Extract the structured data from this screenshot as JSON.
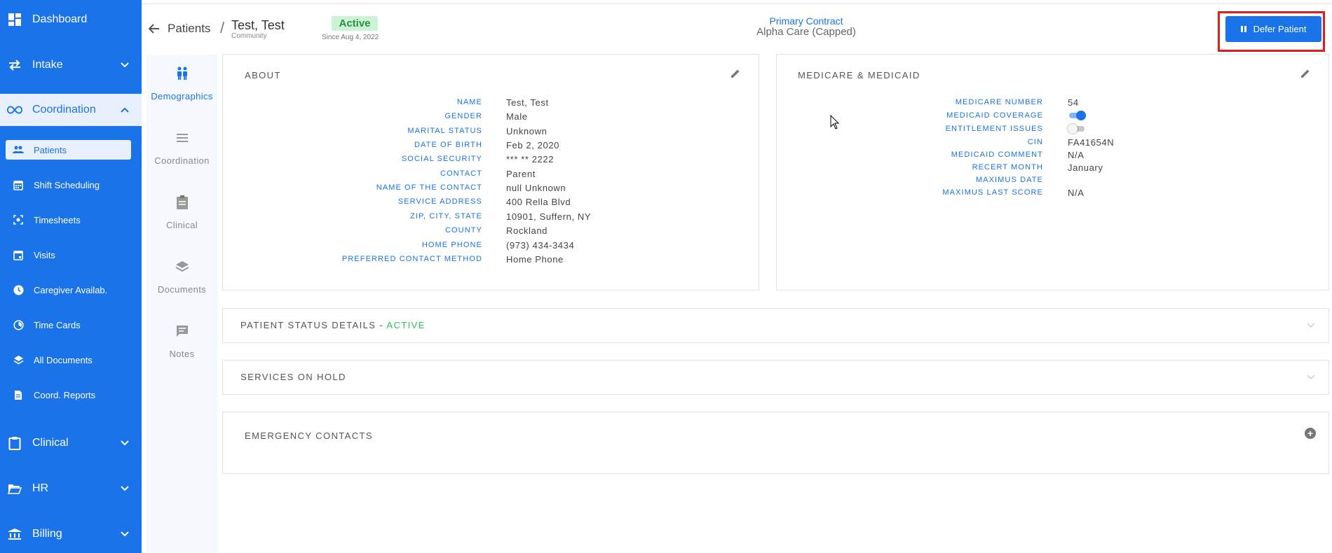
{
  "colors": {
    "primary": "#1a73e8",
    "active_green": "#2cbf5c",
    "badge_bg": "#ccf3d6",
    "highlight_red": "#e41b1b"
  },
  "sidebar": {
    "groups": [
      {
        "label": "Dashboard",
        "icon": "dashboard-icon"
      },
      {
        "label": "Intake",
        "icon": "swap-arrows-icon"
      },
      {
        "label": "Coordination",
        "icon": "infinity-icon"
      },
      {
        "label": "Clinical",
        "icon": "clipboard-icon"
      },
      {
        "label": "HR",
        "icon": "folder-open-icon"
      },
      {
        "label": "Billing",
        "icon": "bank-icon"
      }
    ],
    "coordination_items": [
      {
        "label": "Patients",
        "icon": "people-icon",
        "active": true
      },
      {
        "label": "Shift Scheduling",
        "icon": "calendar-icon"
      },
      {
        "label": "Timesheets",
        "icon": "scan-icon"
      },
      {
        "label": "Visits",
        "icon": "calendar-event-icon"
      },
      {
        "label": "Caregiver Availab.",
        "icon": "clock-icon"
      },
      {
        "label": "Time Cards",
        "icon": "timelapse-icon"
      },
      {
        "label": "All Documents",
        "icon": "layers-icon"
      },
      {
        "label": "Coord. Reports",
        "icon": "document-icon"
      }
    ]
  },
  "header": {
    "breadcrumb": "Patients",
    "patient_name": "Test, Test",
    "patient_type": "Community",
    "status": "Active",
    "since": "Since Aug 4, 2022",
    "contract_label": "Primary Contract",
    "contract_value": "Alpha Care (Capped)",
    "defer_label": "Defer Patient"
  },
  "tabs": [
    {
      "label": "Demographics",
      "icon": "people-icon",
      "active": true
    },
    {
      "label": "Coordination",
      "icon": "list-icon"
    },
    {
      "label": "Clinical",
      "icon": "clipboard-icon"
    },
    {
      "label": "Documents",
      "icon": "layers-icon"
    },
    {
      "label": "Notes",
      "icon": "chat-icon"
    }
  ],
  "about": {
    "title": "ABOUT",
    "fields": [
      {
        "label": "NAME",
        "value": "Test, Test"
      },
      {
        "label": "GENDER",
        "value": "Male"
      },
      {
        "label": "MARITAL STATUS",
        "value": "Unknown"
      },
      {
        "label": "DATE OF BIRTH",
        "value": "Feb 2, 2020"
      },
      {
        "label": "SOCIAL SECURITY",
        "value": "*** ** 2222"
      },
      {
        "label": "CONTACT",
        "value": "Parent"
      },
      {
        "label": "NAME OF THE CONTACT",
        "value": "null Unknown"
      },
      {
        "label": "SERVICE ADDRESS",
        "value": "400 Rella Blvd"
      },
      {
        "label": "ZIP, CITY, STATE",
        "value": "10901, Suffern, NY"
      },
      {
        "label": "COUNTY",
        "value": "Rockland"
      },
      {
        "label": "HOME PHONE",
        "value": "(973) 434-3434"
      },
      {
        "label": "PREFERRED CONTACT METHOD",
        "value": "Home Phone"
      }
    ]
  },
  "medicare": {
    "title": "MEDICARE & MEDICAID",
    "fields": [
      {
        "label": "MEDICARE NUMBER",
        "value": "54"
      },
      {
        "label": "MEDICAID COVERAGE",
        "toggle": true
      },
      {
        "label": "ENTITLEMENT ISSUES",
        "toggle": false
      },
      {
        "label": "CIN",
        "value": "FA41654N"
      },
      {
        "label": "MEDICAID COMMENT",
        "value": "N/A"
      },
      {
        "label": "RECERT MONTH",
        "value": "January"
      },
      {
        "label": "MAXIMUS DATE",
        "value": ""
      },
      {
        "label": "MAXIMUS LAST SCORE",
        "value": "N/A"
      }
    ]
  },
  "patient_status": {
    "title": "PATIENT STATUS DETAILS - ",
    "status": "ACTIVE"
  },
  "services_on_hold": {
    "title": "SERVICES ON HOLD"
  },
  "emergency_contacts": {
    "title": "EMERGENCY CONTACTS"
  }
}
